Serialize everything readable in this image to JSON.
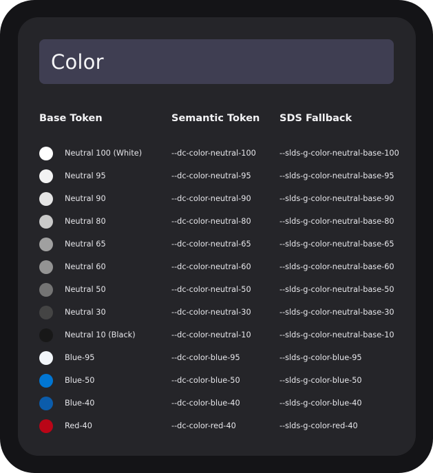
{
  "title": "Color",
  "headers": {
    "base": "Base Token",
    "semantic": "Semantic Token",
    "fallback": "SDS Fallback"
  },
  "rows": [
    {
      "base": "Neutral 100 (White)",
      "semantic": "--dc-color-neutral-100",
      "fallback": "--slds-g-color-neutral-base-100",
      "color": "#ffffff"
    },
    {
      "base": "Neutral 95",
      "semantic": "--dc-color-neutral-95",
      "fallback": "--slds-g-color-neutral-base-95",
      "color": "#f3f3f3"
    },
    {
      "base": "Neutral 90",
      "semantic": "--dc-color-neutral-90",
      "fallback": "--slds-g-color-neutral-base-90",
      "color": "#e5e5e5"
    },
    {
      "base": "Neutral 80",
      "semantic": "--dc-color-neutral-80",
      "fallback": "--slds-g-color-neutral-base-80",
      "color": "#c9c9c9"
    },
    {
      "base": "Neutral 65",
      "semantic": "--dc-color-neutral-65",
      "fallback": "--slds-g-color-neutral-base-65",
      "color": "#a0a0a0"
    },
    {
      "base": "Neutral 60",
      "semantic": "--dc-color-neutral-60",
      "fallback": "--slds-g-color-neutral-base-60",
      "color": "#939393"
    },
    {
      "base": "Neutral 50",
      "semantic": "--dc-color-neutral-50",
      "fallback": "--slds-g-color-neutral-base-50",
      "color": "#747474"
    },
    {
      "base": "Neutral 30",
      "semantic": "--dc-color-neutral-30",
      "fallback": "--slds-g-color-neutral-base-30",
      "color": "#444444"
    },
    {
      "base": "Neutral 10 (Black)",
      "semantic": "--dc-color-neutral-10",
      "fallback": "--slds-g-color-neutral-base-10",
      "color": "#181818"
    },
    {
      "base": "Blue-95",
      "semantic": "--dc-color-blue-95",
      "fallback": "--slds-g-color-blue-95",
      "color": "#f2f6fa"
    },
    {
      "base": "Blue-50",
      "semantic": "--dc-color-blue-50",
      "fallback": "--slds-g-color-blue-50",
      "color": "#0176d3"
    },
    {
      "base": "Blue-40",
      "semantic": "--dc-color-blue-40",
      "fallback": "--slds-g-color-blue-40",
      "color": "#0b5cab"
    },
    {
      "base": "Red-40",
      "semantic": "--dc-color-red-40",
      "fallback": "--slds-g-color-red-40",
      "color": "#ba0517"
    }
  ]
}
